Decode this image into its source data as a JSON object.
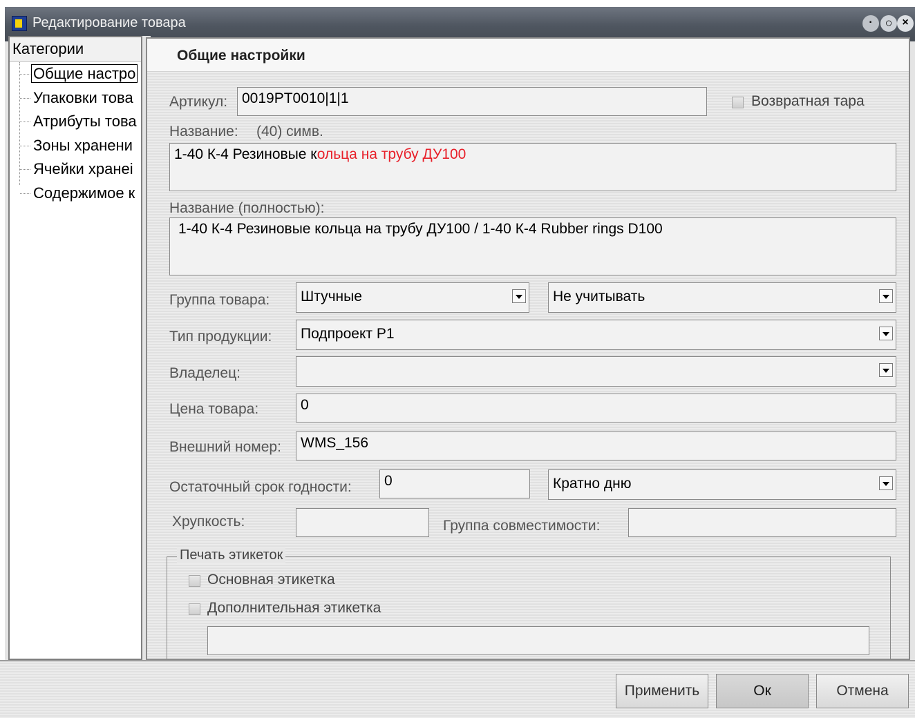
{
  "window": {
    "title": "Редактирование товара"
  },
  "sidebar": {
    "header": "Категории",
    "items": [
      "Общие настро",
      "Упаковки това",
      "Атрибуты това",
      "Зоны хранени",
      "Ячейки хранеі",
      "Содержимое к"
    ]
  },
  "panel": {
    "title": "Общие настройки",
    "article": {
      "label": "Артикул:",
      "value": "0019PT0010|1|1"
    },
    "returnable": {
      "label": "Возвратная тара",
      "checked": false
    },
    "name": {
      "label": "Название:",
      "count": "(40) симв.",
      "value_normal": "1-40 К-4 Резиновые к",
      "value_red": "ольца на трубу ДУ100"
    },
    "full_name": {
      "label": "Название (полностью):",
      "value": "1-40 К-4 Резиновые кольца на трубу ДУ100 / 1-40 К-4 Rubber rings D100"
    },
    "group": {
      "label": "Группа товара:",
      "value": "Штучные",
      "value2": "Не учитывать"
    },
    "product_type": {
      "label": "Тип продукции:",
      "value": "Подпроект Р1"
    },
    "owner": {
      "label": "Владелец:",
      "value": ""
    },
    "price": {
      "label": "Цена товара:",
      "value": "0"
    },
    "external_number": {
      "label": "Внешний номер:",
      "value": "WMS_156"
    },
    "shelf_life": {
      "label": "Остаточный срок годности:",
      "value": "0",
      "unit": "Кратно дню"
    },
    "fragility": {
      "label": "Хрупкость:",
      "value": ""
    },
    "compat_group": {
      "label": "Группа совместимости:",
      "value": ""
    },
    "label_print": {
      "title": "Печать этикеток",
      "main": {
        "label": "Основная этикетка",
        "checked": false
      },
      "extra": {
        "label": "Дополнительная этикетка",
        "checked": false
      },
      "extra_value": ""
    }
  },
  "buttons": {
    "apply": "Применить",
    "ok": "Ок",
    "cancel": "Отмена"
  },
  "colors": {
    "accent_red": "#e8202a",
    "titlebar": "#4f5660"
  }
}
